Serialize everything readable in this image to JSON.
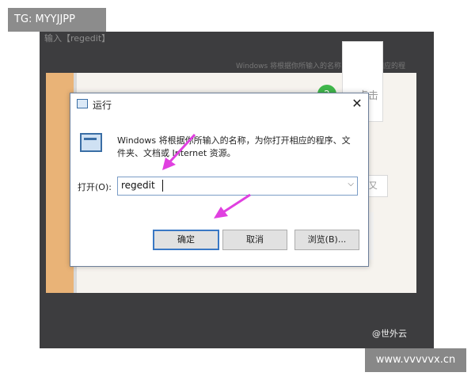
{
  "overlay": {
    "tg_label": "TG: MYYJJPP",
    "watermark": "@世外云",
    "url_label": "www.vvvvvx.cn"
  },
  "background": {
    "header_text_1": "输入【regedit】",
    "header_text_2": "Windows 将根据你所输入的名称，为你打开相应的程",
    "badge_number": "2",
    "side_text": "点击",
    "side_button": "+ 又"
  },
  "dialog": {
    "title": "运行",
    "description": "Windows 将根据你所输入的名称，为你打开相应的程序、文件夹、文档或 Internet 资源。",
    "open_label": "打开(O):",
    "input_value": "regedit",
    "buttons": {
      "ok": "确定",
      "cancel": "取消",
      "browse": "浏览(B)..."
    }
  },
  "colors": {
    "annotation_arrow": "#e040e0",
    "ok_border": "#3a78c4",
    "badge_green": "#3fb64a"
  }
}
